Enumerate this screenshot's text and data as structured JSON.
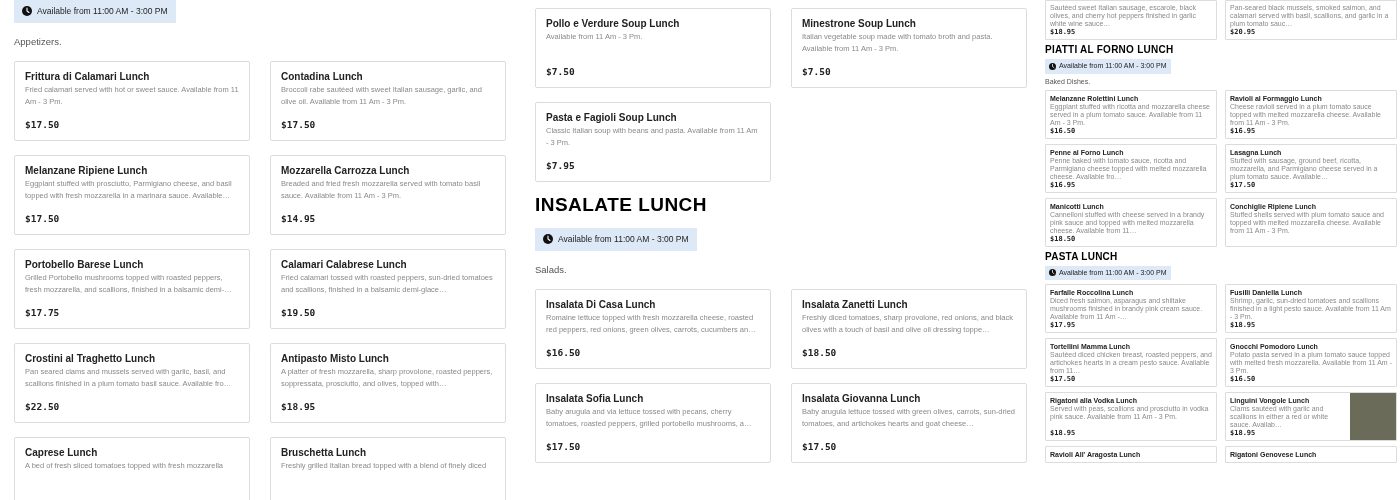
{
  "panels": [
    {
      "kind": "full",
      "blocks": [
        {
          "kind": "availability",
          "text": "Available from 11:00 AM - 3:00 PM"
        },
        {
          "kind": "note",
          "text": "Appetizers."
        },
        {
          "kind": "grid",
          "cards": [
            {
              "name": "Frittura di Calamari Lunch",
              "description": "Fried calamari served with hot or sweet sauce. Available from 11 Am - 3 Pm.",
              "price": "$17.50"
            },
            {
              "name": "Contadina Lunch",
              "description": "Broccoli rabe sautéed with sweet Italian sausage, garlic, and olive oil. Available from 11 Am - 3 Pm.",
              "price": "$17.50"
            },
            {
              "name": "Melanzane Ripiene Lunch",
              "description": "Eggplant stuffed with prosciutto, Parmigiano cheese, and basil topped with fresh mozzarella in a marinara sauce. Available…",
              "price": "$17.50"
            },
            {
              "name": "Mozzarella Carrozza Lunch",
              "description": "Breaded and fried fresh mozzarella served with tomato basil sauce. Available from 11 Am - 3 Pm.",
              "price": "$14.95"
            },
            {
              "name": "Portobello Barese Lunch",
              "description": "Grilled Portobello mushrooms topped with roasted peppers, fresh mozzarella, and scallions, finished in a balsamic demi-…",
              "price": "$17.75"
            },
            {
              "name": "Calamari Calabrese Lunch",
              "description": "Fried calamari tossed with roasted peppers, sun-dried tomatoes and scallions, finished in a balsamic demi-glace…",
              "price": "$19.50"
            },
            {
              "name": "Crostini al Traghetto Lunch",
              "description": "Pan seared clams and mussels served with garlic, basil, and scallions finished in a plum tomato basil sauce. Available fro…",
              "price": "$22.50"
            },
            {
              "name": "Antipasto Misto Lunch",
              "description": "A platter of fresh mozzarella, sharp provolone, roasted peppers, soppressata, prosciutto, and olives, topped with…",
              "price": "$18.95"
            },
            {
              "name": "Caprese Lunch",
              "description": "A bed of fresh sliced tomatoes topped with fresh mozzarella"
            },
            {
              "name": "Bruschetta Lunch",
              "description": "Freshly grilled Italian bread topped with a blend of finely diced"
            }
          ]
        }
      ]
    },
    {
      "kind": "full",
      "blocks": [
        {
          "kind": "grid",
          "cards": [
            {
              "name": "Pollo e Verdure Soup Lunch",
              "description": "Available from 11 Am - 3 Pm.",
              "price": "$7.50"
            },
            {
              "name": "Minestrone Soup Lunch",
              "description": "Italian vegetable soup made with tomato broth and pasta. Available from 11 Am - 3 Pm.",
              "price": "$7.50"
            },
            {
              "name": "Pasta e Fagioli Soup Lunch",
              "description": "Classic Italian soup with beans and pasta. Available from 11 Am - 3 Pm.",
              "price": "$7.95"
            }
          ]
        },
        {
          "kind": "heading",
          "text": "INSALATE LUNCH"
        },
        {
          "kind": "availability",
          "text": "Available from 11:00 AM - 3:00 PM"
        },
        {
          "kind": "note",
          "text": "Salads."
        },
        {
          "kind": "grid",
          "cards": [
            {
              "name": "Insalata Di Casa Lunch",
              "description": "Romaine lettuce topped with fresh mozzarella cheese, roasted red peppers, red onions, green olives, carrots, cucumbers an…",
              "price": "$16.50"
            },
            {
              "name": "Insalata Zanetti Lunch",
              "description": "Freshly diced tomatoes, sharp provolone, red onions, and black olives with a touch of basil and olive oil dressing toppe…",
              "price": "$18.50"
            },
            {
              "name": "Insalata Sofia Lunch",
              "description": "Baby arugula and via lettuce tossed with pecans, cherry tomatoes, roasted peppers, grilled portobello mushrooms, a…",
              "price": "$17.50"
            },
            {
              "name": "Insalata Giovanna Lunch",
              "description": "Baby arugula lettuce tossed with green olives, carrots, sun-dried tomatoes, and artichokes hearts and goat cheese…",
              "price": "$17.50"
            }
          ]
        }
      ]
    },
    {
      "kind": "thumbnail",
      "blocks": [
        {
          "kind": "grid",
          "cards": [
            {
              "description": "Sautéed sweet Italian sausage, escarole, black olives, and cherry hot peppers finished in garlic white wine sauce…",
              "price": "$18.95"
            },
            {
              "description": "Pan-seared black mussels, smoked salmon, and calamari served with basil, scallions, and garlic in a plum tomato sauc…",
              "price": "$20.95"
            }
          ]
        },
        {
          "kind": "heading",
          "text": "PIATTI AL FORNO LUNCH"
        },
        {
          "kind": "availability",
          "text": "Available from 11:00 AM - 3:00 PM"
        },
        {
          "kind": "note",
          "text": "Baked Dishes."
        },
        {
          "kind": "grid",
          "cards": [
            {
              "name": "Melanzane Rolettini Lunch",
              "description": "Eggplant stuffed with ricotta and mozzarella cheese served in a plum tomato sauce. Available from 11 Am - 3 Pm.",
              "price": "$16.50"
            },
            {
              "name": "Ravioli al Formaggio Lunch",
              "description": "Cheese ravioli served in a plum tomato sauce topped with melted mozzarella cheese. Available from 11 Am - 3 Pm.",
              "price": "$16.95"
            },
            {
              "name": "Penne al Forno Lunch",
              "description": "Penne baked with tomato sauce, ricotta and Parmigiano cheese topped with melted mozzarella cheese. Available fro…",
              "price": "$16.95"
            },
            {
              "name": "Lasagna Lunch",
              "description": "Stuffed with sausage, ground beef, ricotta, mozzarella, and Parmigiano cheese served in a plum tomato sauce. Available…",
              "price": "$17.50"
            },
            {
              "name": "Manicotti Lunch",
              "description": "Cannelloni stuffed with cheese served in a brandy pink sauce and topped with melted mozzarella cheese. Available from 11…",
              "price": "$18.50"
            },
            {
              "name": "Conchiglie Ripiene Lunch",
              "description": "Stuffed shells served with plum tomato sauce and topped with melted mozzarella cheese. Available from 11 Am - 3 Pm."
            }
          ]
        },
        {
          "kind": "heading",
          "text": "PASTA LUNCH"
        },
        {
          "kind": "availability",
          "text": "Available from 11:00 AM - 3:00 PM"
        },
        {
          "kind": "grid",
          "cards": [
            {
              "name": "Farfalle Roccolina Lunch",
              "description": "Diced fresh salmon, asparagus and shiitake mushrooms finished in brandy pink cream sauce. Available from 11 Am -…",
              "price": "$17.95"
            },
            {
              "name": "Fusilli Daniella Lunch",
              "description": "Shrimp, garlic, sun-dried tomatoes and scallions finished in a light pesto sauce. Available from 11 Am - 3 Pm.",
              "price": "$18.95"
            },
            {
              "name": "Tortellini Mamma Lunch",
              "description": "Sautéed diced chicken breast, roasted peppers, and artichokes hearts in a cream pesto sauce. Available from 11…",
              "price": "$17.50"
            },
            {
              "name": "Gnocchi Pomodoro Lunch",
              "description": "Potato pasta served in a plum tomato sauce topped with melted fresh mozzarella. Available from 11 Am - 3 Pm.",
              "price": "$16.50"
            },
            {
              "name": "Rigatoni alla Vodka Lunch",
              "description": "Served with peas, scallions and prosciutto in vodka pink sauce. Available from 11 Am - 3 Pm.",
              "price": "$18.95"
            },
            {
              "name": "Linguini Vongole Lunch",
              "description": "Clams sautéed with garlic and scallions in either a red or white sauce. Availab…",
              "price": "$18.95",
              "photo": true
            },
            {
              "name": "Ravioli All' Aragosta Lunch"
            },
            {
              "name": "Rigatoni Genovese Lunch"
            }
          ]
        }
      ]
    }
  ]
}
